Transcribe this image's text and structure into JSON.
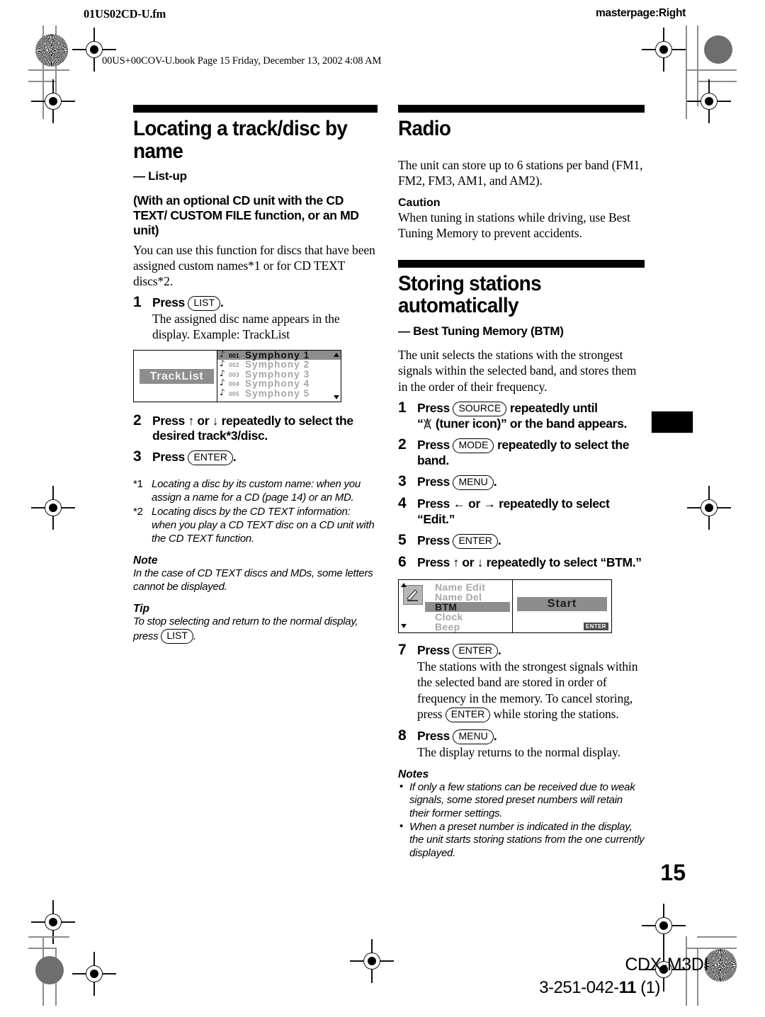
{
  "header": {
    "file_name": "01US02CD-U.fm",
    "masterpage": "masterpage:Right",
    "book_line": "00US+00COV-U.book  Page 15  Friday, December 13, 2002  4:08 AM"
  },
  "left_column": {
    "section_title": "Locating a track/disc by name",
    "subtitle_dash": "— List-up",
    "bold_intro": "(With an optional CD unit with the CD TEXT/ CUSTOM FILE function, or an MD unit)",
    "intro_paragraph": "You can use this function for discs that have been assigned custom names*1 or for CD TEXT discs*2.",
    "steps": [
      {
        "num": "1",
        "label_before": "Press",
        "key": "LIST",
        "label_after": ".",
        "description": "The assigned disc name appears in the display. Example: TrackList"
      },
      {
        "num": "2",
        "text": "Press ↑ or ↓ repeatedly to select the desired track*3/disc."
      },
      {
        "num": "3",
        "label_before": "Press",
        "key": "ENTER",
        "label_after": "."
      }
    ],
    "lcd_tracklist": {
      "disc_name": "TrackList",
      "rows": [
        {
          "index": "001",
          "name": "Symphony 1",
          "selected": true
        },
        {
          "index": "002",
          "name": "Symphony 2",
          "selected": false
        },
        {
          "index": "003",
          "name": "Symphony 3",
          "selected": false
        },
        {
          "index": "004",
          "name": "Symphony 4",
          "selected": false
        },
        {
          "index": "005",
          "name": "Symphony 5",
          "selected": false
        }
      ]
    },
    "footnotes": [
      {
        "mark": "*1",
        "text": "Locating a disc by its custom name: when you assign a name for a CD (page 14) or an MD."
      },
      {
        "mark": "*2",
        "text": "Locating discs by the CD TEXT information: when you play a CD TEXT disc on a CD unit with the CD TEXT function."
      }
    ],
    "note_heading": "Note",
    "note_text": "In the case of CD TEXT discs and MDs, some letters cannot be displayed.",
    "tip_heading": "Tip",
    "tip_before": "To stop selecting and return to the normal display, press",
    "tip_key": "LIST",
    "tip_after": "."
  },
  "right_column": {
    "section_title": "Radio",
    "intro_paragraph": "The unit can store up to 6 stations per band (FM1, FM2, FM3, AM1, and AM2).",
    "caution_heading": "Caution",
    "caution_text": "When tuning in stations while driving, use Best Tuning Memory to prevent accidents.",
    "section2_title": "Storing stations automatically",
    "section2_dash": "— Best Tuning Memory (BTM)",
    "section2_intro": "The unit selects the stations with the strongest signals within the selected band, and stores them in the order of their frequency.",
    "steps": [
      {
        "num": "1",
        "label_before": "Press",
        "key": "SOURCE",
        "label_after": "repeatedly until",
        "line2_prefix": "“",
        "line2_icon": "tuner-icon",
        "line2_suffix": " (tuner icon)” or the band appears."
      },
      {
        "num": "2",
        "label_before": "Press",
        "key": "MODE",
        "label_after": "repeatedly to select the band."
      },
      {
        "num": "3",
        "label_before": "Press",
        "key": "MENU",
        "label_after": "."
      },
      {
        "num": "4",
        "text": "Press ← or → repeatedly to select “Edit.”"
      },
      {
        "num": "5",
        "label_before": "Press",
        "key": "ENTER",
        "label_after": "."
      },
      {
        "num": "6",
        "text": "Press ↑ or ↓ repeatedly to select “BTM.”"
      },
      {
        "num": "7",
        "label_before": "Press",
        "key": "ENTER",
        "label_after": ".",
        "desc_part1": "The stations with the strongest signals within the selected band are stored in order of frequency in the memory. To cancel storing, press",
        "desc_key": "ENTER",
        "desc_part2": "while storing the stations."
      },
      {
        "num": "8",
        "label_before": "Press",
        "key": "MENU",
        "label_after": ".",
        "description": "The display returns to the normal display."
      }
    ],
    "lcd_btm": {
      "icon": "pencil-icon",
      "menu_items": [
        {
          "label": "Name Edit",
          "selected": false
        },
        {
          "label": "Name Del",
          "selected": false
        },
        {
          "label": "BTM",
          "selected": true
        },
        {
          "label": "Clock",
          "selected": false
        },
        {
          "label": "Beep",
          "selected": false
        }
      ],
      "start_label": "Start",
      "enter_badge": "ENTER"
    },
    "notes_heading": "Notes",
    "notes": [
      "If only a few stations can be received due to weak signals, some stored preset numbers will retain their former settings.",
      "When a preset number is indicated in the display, the unit starts storing stations from the one currently displayed."
    ]
  },
  "footer": {
    "page_number": "15",
    "model": "CDX-M3DI",
    "part_number_main": "3-251-042-",
    "part_number_bold": "11",
    "part_number_rev": " (1)"
  }
}
